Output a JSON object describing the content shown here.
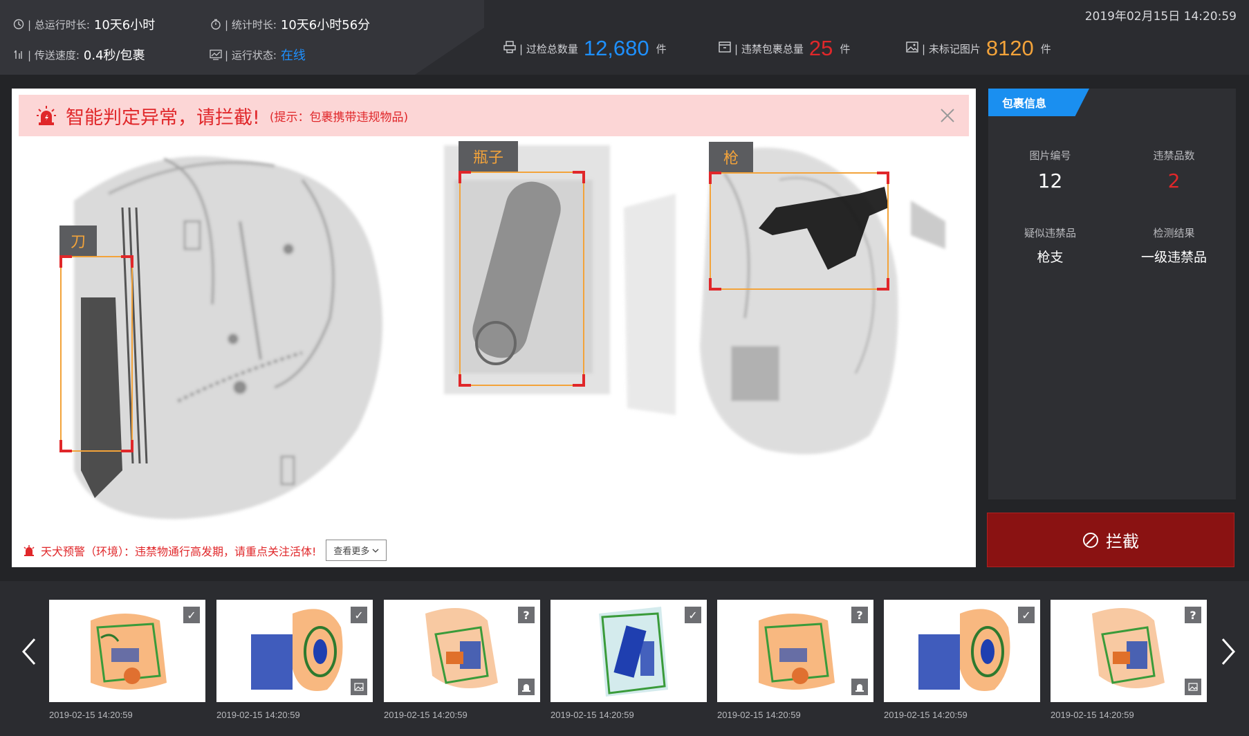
{
  "header": {
    "datetime": "2019年02月15日  14:20:59",
    "total_runtime_label": "| 总运行时长:",
    "total_runtime": "10天6小时",
    "stat_duration_label": "| 统计时长:",
    "stat_duration": "10天6小时56分",
    "speed_label": "| 传送速度:",
    "speed": "0.4秒/包裹",
    "status_label": "| 运行状态:",
    "status": "在线",
    "status_color": "#1e90ff",
    "inspected_label": "| 过检总数量",
    "inspected": "12,680",
    "inspected_unit": "件",
    "inspected_color": "#1e90ff",
    "contraband_label": "| 违禁包裹总量",
    "contraband": "25",
    "contraband_unit": "件",
    "contraband_color": "#e0272a",
    "unmarked_label": "| 未标记图片",
    "unmarked": "8120",
    "unmarked_unit": "件",
    "unmarked_color": "#f3a33a"
  },
  "alert": {
    "message": "智能判定异常，请拦截!",
    "hint": "(提示：包裹携带违规物品)",
    "icon": "siren-icon"
  },
  "detections": [
    {
      "label": "刀"
    },
    {
      "label": "瓶子"
    },
    {
      "label": "枪"
    }
  ],
  "warning": {
    "text": "天犬预警（环境）：违禁物通行高发期，请重点关注活体!",
    "more": "查看更多"
  },
  "panel": {
    "tab": "包裹信息",
    "image_no_label": "图片编号",
    "image_no": "12",
    "contraband_count_label": "违禁品数",
    "contraband_count": "2",
    "suspect_label": "疑似违禁品",
    "suspect": "枪支",
    "result_label": "检测结果",
    "result": "一级违禁品"
  },
  "block_button": "拦截",
  "thumbnails": [
    {
      "date": "2019-02-15  14:20:59",
      "status": "check",
      "extra": "none"
    },
    {
      "date": "2019-02-15  14:20:59",
      "status": "check",
      "extra": "image"
    },
    {
      "date": "2019-02-15  14:20:59",
      "status": "question",
      "extra": "alarm"
    },
    {
      "date": "2019-02-15  14:20:59",
      "status": "check",
      "extra": "none"
    },
    {
      "date": "2019-02-15  14:20:59",
      "status": "question",
      "extra": "alarm"
    },
    {
      "date": "2019-02-15  14:20:59",
      "status": "check",
      "extra": "none"
    },
    {
      "date": "2019-02-15  14:20:59",
      "status": "question",
      "extra": "image"
    }
  ]
}
